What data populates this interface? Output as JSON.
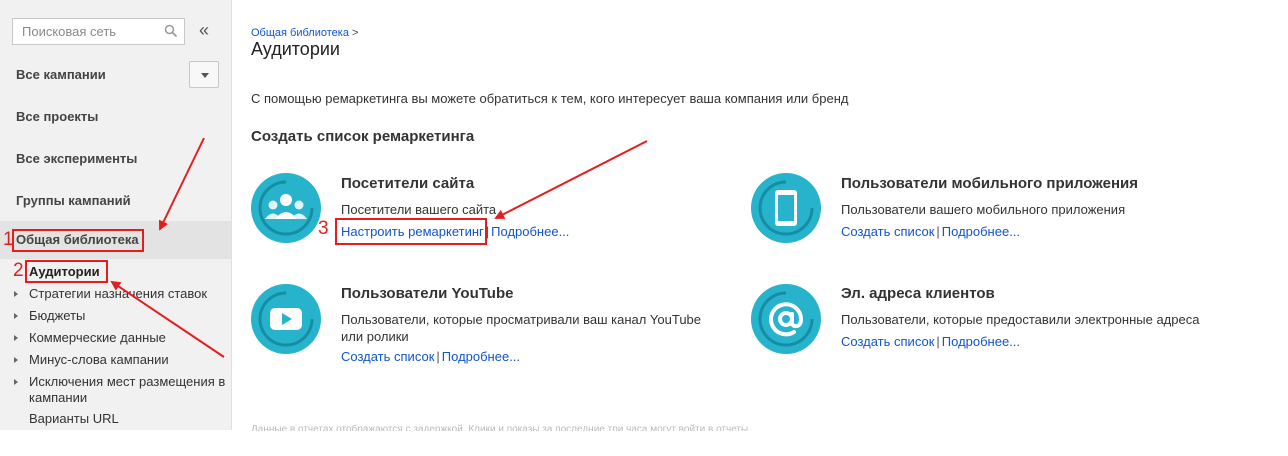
{
  "sidebar": {
    "search_placeholder": "Поисковая сеть",
    "collapse_icon": "«",
    "nav_items": [
      {
        "label": "Все кампании"
      },
      {
        "label": "Все проекты"
      },
      {
        "label": "Все эксперименты"
      },
      {
        "label": "Группы кампаний"
      },
      {
        "label": "Общая библиотека"
      }
    ],
    "sub_items": [
      {
        "label": "Аудитории"
      },
      {
        "label": "Стратегии назначения ставок"
      },
      {
        "label": "Бюджеты"
      },
      {
        "label": "Коммерческие данные"
      },
      {
        "label": "Минус-слова кампании"
      },
      {
        "label": "Исключения мест размещения в кампании"
      },
      {
        "label": "Варианты URL"
      }
    ]
  },
  "main": {
    "breadcrumb_link": "Общая библиотека",
    "breadcrumb_sep": ">",
    "title": "Аудитории",
    "intro": "С помощью ремаркетинга вы можете обратиться к тем, кого интересует ваша компания или бренд",
    "section_title": "Создать список ремаркетинга",
    "cards": [
      {
        "title": "Посетители сайта",
        "desc": "Посетители вашего сайта",
        "link1": "Настроить ремаркетинг",
        "sep": "|",
        "link2": "Подробнее..."
      },
      {
        "title": "Пользователи мобильного приложения",
        "desc": "Пользователи вашего мобильного приложения",
        "link1": "Создать список",
        "sep": "|",
        "link2": "Подробнее..."
      },
      {
        "title": "Пользователи YouTube",
        "desc": "Пользователи, которые просматривали ваш канал YouTube или ролики",
        "link1": "Создать список",
        "sep": "|",
        "link2": "Подробнее..."
      },
      {
        "title": "Эл. адреса клиентов",
        "desc": "Пользователи, которые предоставили электронные адреса",
        "link1": "Создать список",
        "sep": "|",
        "link2": "Подробнее..."
      }
    ],
    "footer": "Данные в отчетах отображаются с задержкой. Клики и показы за последние три часа могут войти в отчеты."
  },
  "annotations": {
    "num1": "1",
    "num2": "2",
    "num3": "3"
  },
  "colors": {
    "icon_teal": "#27b3cc",
    "icon_dark": "#158ea3",
    "link": "#1155cc",
    "annotation_red": "#e41e1e"
  },
  "icons": [
    "search-icon",
    "collapse-icon",
    "chevron-down-icon",
    "audience-icon",
    "mobile-phone-icon",
    "youtube-play-icon",
    "at-sign-icon"
  ]
}
